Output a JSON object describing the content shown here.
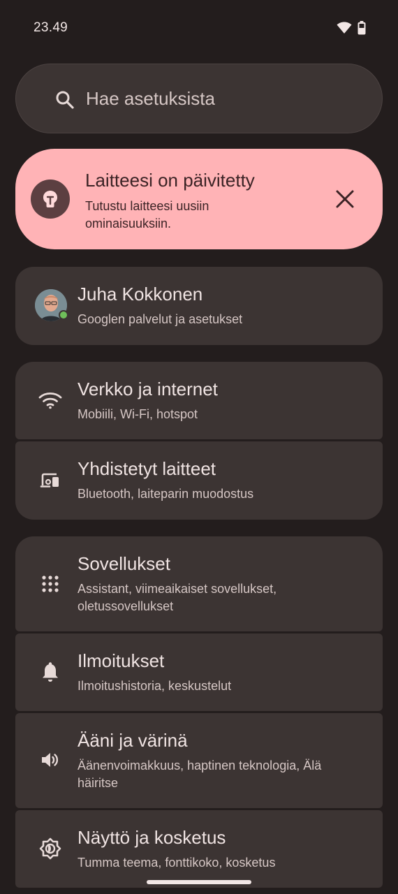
{
  "status_bar": {
    "time": "23.49"
  },
  "search": {
    "placeholder": "Hae asetuksista"
  },
  "banner": {
    "title": "Laitteesi on päivitetty",
    "subtitle": "Tutustu laitteesi uusiin ominaisuuksiin."
  },
  "account": {
    "name": "Juha Kokkonen",
    "subtitle": "Googlen palvelut ja asetukset"
  },
  "items": [
    {
      "title": "Verkko ja internet",
      "subtitle": "Mobiili, Wi-Fi, hotspot",
      "icon": "wifi-icon"
    },
    {
      "title": "Yhdistetyt laitteet",
      "subtitle": "Bluetooth, laiteparin muodostus",
      "icon": "connected-devices-icon"
    },
    {
      "title": "Sovellukset",
      "subtitle": "Assistant, viimeaikaiset sovellukset, oletussovellukset",
      "icon": "apps-grid-icon"
    },
    {
      "title": "Ilmoitukset",
      "subtitle": "Ilmoitushistoria, keskustelut",
      "icon": "bell-icon"
    },
    {
      "title": "Ääni ja värinä",
      "subtitle": "Äänenvoimakkuus, haptinen teknologia, Älä häiritse",
      "icon": "speaker-icon"
    },
    {
      "title": "Näyttö ja kosketus",
      "subtitle": "Tumma teema, fonttikoko, kosketus",
      "icon": "display-brightness-icon"
    }
  ],
  "colors": {
    "background": "#231d1d",
    "card": "#3c3433",
    "banner": "#ffb3b6"
  }
}
